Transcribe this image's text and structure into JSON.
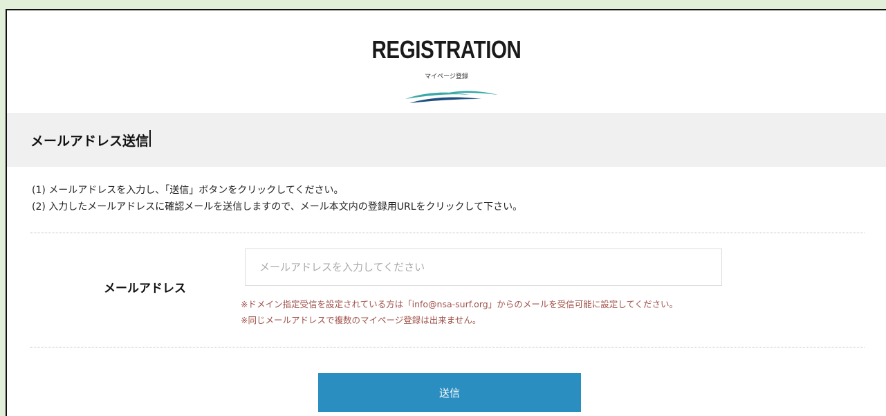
{
  "header": {
    "logo_title": "REGISTRATION",
    "logo_subtitle": "マイページ登録"
  },
  "section": {
    "title": "メールアドレス送信"
  },
  "instructions": [
    "(1) メールアドレスを入力し、「送信」ボタンをクリックしてください。",
    "(2) 入力したメールアドレスに確認メールを送信しますので、メール本文内の登録用URLをクリックして下さい。"
  ],
  "form": {
    "email_label": "メールアドレス",
    "email_placeholder": "メールアドレスを入力してください",
    "email_value": "",
    "notes": [
      "※ドメイン指定受信を設定されている方は「info@nsa-surf.org」からのメールを受信可能に設定してください。",
      "※同じメールアドレスで複数のマイページ登録は出来ません。"
    ],
    "submit_label": "送信"
  },
  "colors": {
    "page_background": "#e2efd9",
    "section_bar": "#f0f0f0",
    "note_text": "#a0524a",
    "button": "#2a8ec0",
    "wave_dark": "#1f4f7f",
    "wave_teal": "#3aa9a8"
  },
  "icons": {
    "logo_wave": "wave-logo-icon"
  }
}
